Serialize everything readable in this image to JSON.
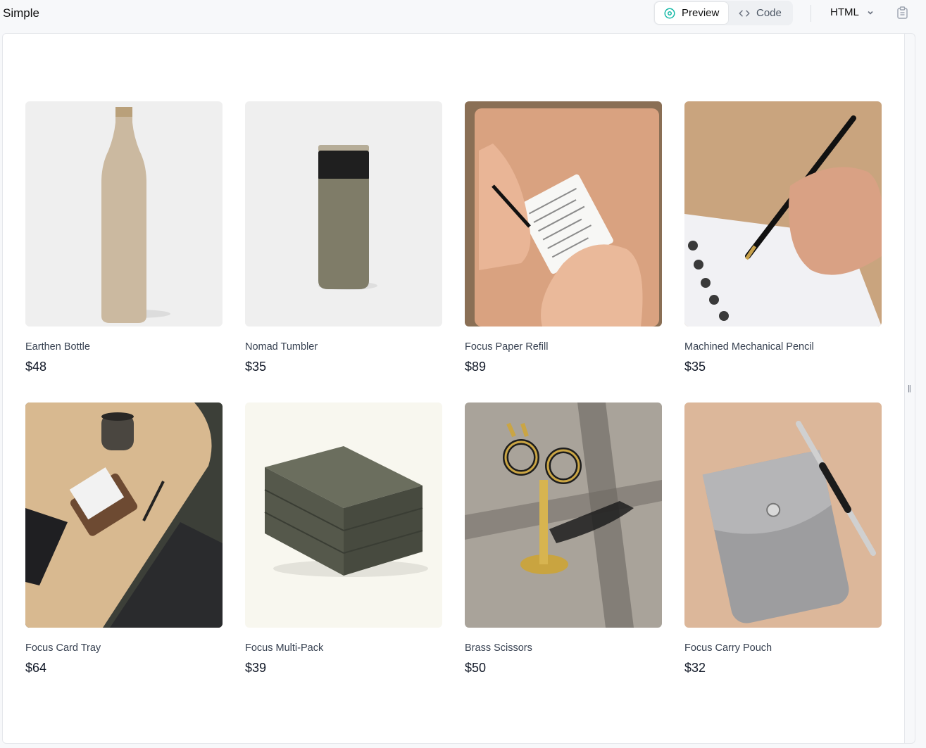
{
  "app": {
    "title": "Simple"
  },
  "toolbar": {
    "preview_label": "Preview",
    "code_label": "Code",
    "language": "HTML",
    "active_tab": "Preview"
  },
  "colors": {
    "accent": "#14b8a6",
    "text": "#111827",
    "muted": "#374151"
  },
  "products": [
    {
      "name": "Earthen Bottle",
      "price": "$48",
      "image": "earthen-bottle"
    },
    {
      "name": "Nomad Tumbler",
      "price": "$35",
      "image": "nomad-tumbler"
    },
    {
      "name": "Focus Paper Refill",
      "price": "$89",
      "image": "focus-paper-refill"
    },
    {
      "name": "Machined Mechanical Pencil",
      "price": "$35",
      "image": "mechanical-pencil"
    },
    {
      "name": "Focus Card Tray",
      "price": "$64",
      "image": "focus-card-tray"
    },
    {
      "name": "Focus Multi-Pack",
      "price": "$39",
      "image": "focus-multi-pack"
    },
    {
      "name": "Brass Scissors",
      "price": "$50",
      "image": "brass-scissors"
    },
    {
      "name": "Focus Carry Pouch",
      "price": "$32",
      "image": "focus-carry-pouch"
    }
  ]
}
